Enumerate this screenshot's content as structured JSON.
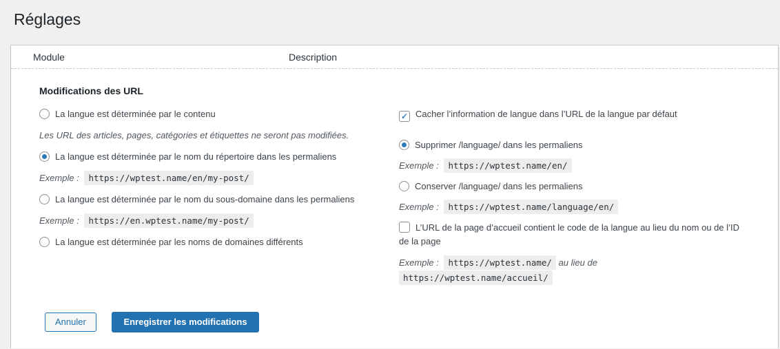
{
  "colors": {
    "accent": "#2271b1",
    "control_checked": "#3582c4",
    "page_background": "#f0f0f1",
    "panel_border": "#c3c4c7",
    "code_background": "#ededee"
  },
  "icons": {
    "checkmark": "✓"
  },
  "page": {
    "title": "Réglages"
  },
  "table": {
    "module_header": "Module",
    "description_header": "Description"
  },
  "url_settings": {
    "heading": "Modifications des URL",
    "example_label": "Exemple :",
    "mode_options": [
      {
        "label": "La langue est déterminée par le contenu",
        "selected": false
      },
      {
        "label": "La langue est déterminée par le nom du répertoire dans les permaliens",
        "selected": true
      },
      {
        "label": "La langue est déterminée par le nom du sous-domaine dans les permaliens",
        "selected": false
      },
      {
        "label": "La langue est déterminée par les noms de domaines différents",
        "selected": false
      }
    ],
    "content_mode_note": "Les URL des articles, pages, catégories et étiquettes ne seront pas modifiées.",
    "directory_example": "https://wptest.name/en/my-post/",
    "subdomain_example": "https://en.wptest.name/my-post/",
    "hide_default_language": {
      "label": "Cacher l’information de langue dans l’URL de la langue par défaut",
      "checked": true
    },
    "rewrite_options": [
      {
        "label": "Supprimer /language/ dans les permaliens",
        "selected": true,
        "example": "https://wptest.name/en/"
      },
      {
        "label": "Conserver /language/ dans les permaliens",
        "selected": false,
        "example": "https://wptest.name/language/en/"
      }
    ],
    "homepage_language_code": {
      "label": "L’URL de la page d’accueil contient le code de la langue au lieu du nom ou de l’ID de la page",
      "checked": false,
      "example_code": "https://wptest.name/",
      "example_middle": "au lieu de",
      "example_code_alt": "https://wptest.name/accueil/"
    }
  },
  "buttons": {
    "cancel": "Annuler",
    "save": "Enregistrer les modifications"
  }
}
